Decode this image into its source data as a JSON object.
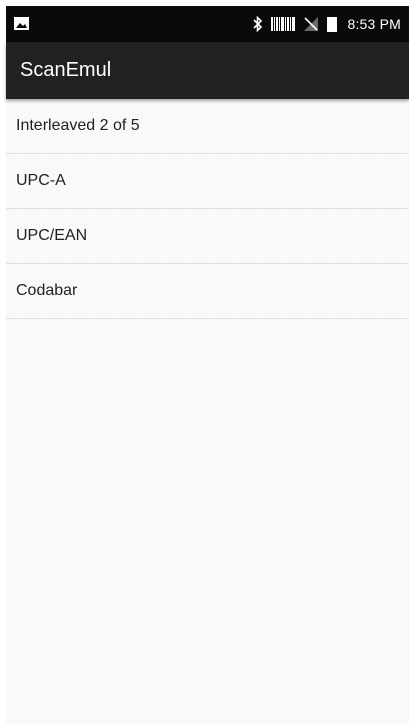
{
  "status_bar": {
    "time": "8:53 PM",
    "icons": [
      "image-notification-icon",
      "bluetooth-icon",
      "barcode-icon",
      "no-signal-icon",
      "battery-icon"
    ]
  },
  "app_bar": {
    "title": "ScanEmul"
  },
  "list": {
    "items": [
      {
        "label": "Interleaved 2 of 5"
      },
      {
        "label": "UPC-A"
      },
      {
        "label": "UPC/EAN"
      },
      {
        "label": "Codabar"
      }
    ]
  },
  "colors": {
    "status_bar_bg": "#0a0a0a",
    "app_bar_bg": "#212121",
    "content_bg": "#fafafa",
    "divider": "#e0e0e0",
    "text_primary": "#212121"
  }
}
